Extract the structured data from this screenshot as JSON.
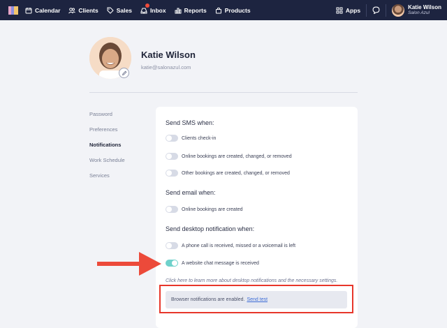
{
  "nav": {
    "items": [
      {
        "label": "Calendar",
        "icon": "calendar-icon"
      },
      {
        "label": "Clients",
        "icon": "clients-icon"
      },
      {
        "label": "Sales",
        "icon": "tag-icon"
      },
      {
        "label": "Inbox",
        "icon": "inbox-icon"
      },
      {
        "label": "Reports",
        "icon": "bar-chart-icon"
      },
      {
        "label": "Products",
        "icon": "bag-icon"
      }
    ],
    "apps_label": "Apps",
    "user_name": "Katie Wilson",
    "user_salon": "Salon Azul"
  },
  "profile": {
    "name": "Katie Wilson",
    "email": "katie@salonazul.com"
  },
  "sidebar": {
    "items": [
      {
        "label": "Password",
        "active": false
      },
      {
        "label": "Preferences",
        "active": false
      },
      {
        "label": "Notifications",
        "active": true
      },
      {
        "label": "Work Schedule",
        "active": false
      },
      {
        "label": "Services",
        "active": false
      }
    ]
  },
  "settings": {
    "sms_title": "Send SMS when:",
    "sms_options": [
      {
        "label": "Clients check-in",
        "on": false
      },
      {
        "label": "Online bookings are created, changed, or removed",
        "on": false
      },
      {
        "label": "Other bookings are created, changed, or removed",
        "on": false
      }
    ],
    "email_title": "Send email when:",
    "email_options": [
      {
        "label": "Online bookings are created",
        "on": false
      }
    ],
    "desktop_title": "Send desktop notification when:",
    "desktop_options": [
      {
        "label": "A phone call is received, missed or a voicemail is left",
        "on": false
      },
      {
        "label": "A website chat message is received",
        "on": true
      }
    ],
    "learn_more": "Click here to learn more about desktop notifications and the necessary settings.",
    "notice_text": "Browser notifications are enabled.",
    "notice_link": "Send test"
  },
  "colors": {
    "nav_bg": "#1d2440",
    "toggle_on": "#6fd1cb",
    "annotation": "#e7362a"
  }
}
